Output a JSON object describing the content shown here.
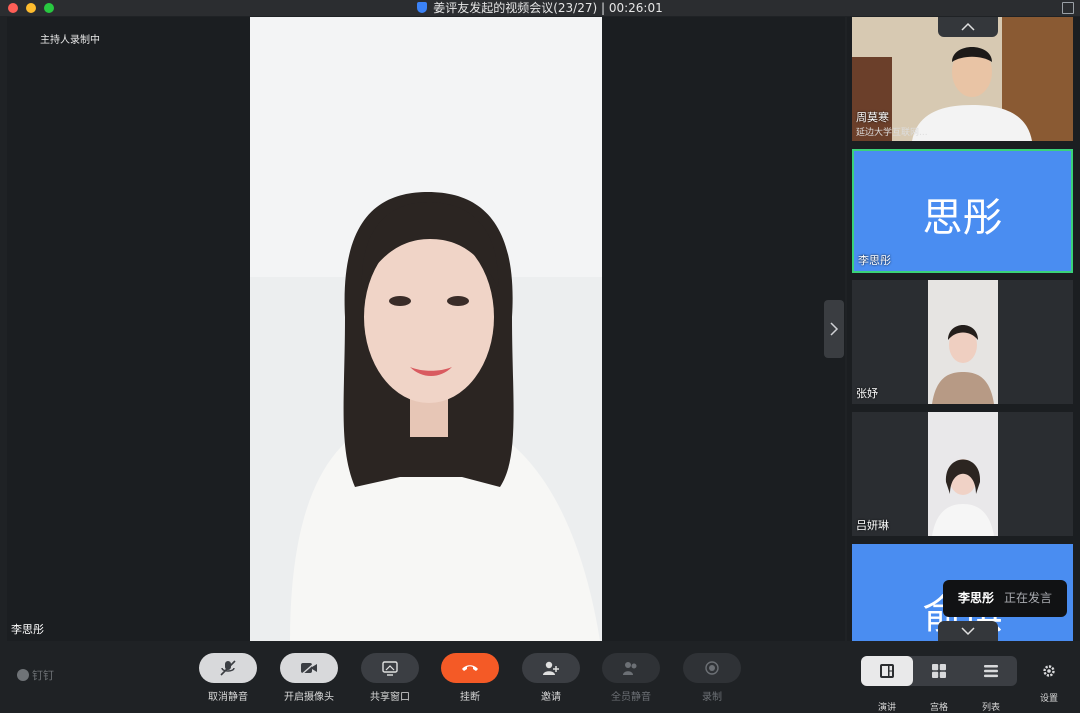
{
  "window": {
    "title": "姜评友发起的视频会议(23/27) | 00:26:01"
  },
  "stage": {
    "recording_status": "主持人录制中",
    "main_speaker_name": "李思彤"
  },
  "participants": [
    {
      "name": "周莫寒",
      "subtitle": "延边大学互联网...",
      "type": "video"
    },
    {
      "name": "李思彤",
      "avatar_text": "思彤",
      "type": "avatar",
      "selected": true
    },
    {
      "name": "张妤",
      "type": "video"
    },
    {
      "name": "吕妍琳",
      "type": "video"
    },
    {
      "name": "",
      "avatar_text": "俞琪",
      "type": "avatar"
    }
  ],
  "toast": {
    "name": "李思彤",
    "status": "正在发言"
  },
  "brand": {
    "label": "钉钉"
  },
  "toolbar": {
    "unmute": "取消静音",
    "camera": "开启摄像头",
    "share": "共享窗口",
    "hangup": "挂断",
    "invite": "邀请",
    "mute_all": "全员静音",
    "record": "录制"
  },
  "layouts": {
    "speaker": "演讲",
    "grid": "宫格",
    "list": "列表",
    "active": "speaker"
  },
  "settings": {
    "label": "设置"
  },
  "colors": {
    "hangup": "#f45a26",
    "avatar_bg": "#4a8df1",
    "active_border": "#3ad27a"
  }
}
